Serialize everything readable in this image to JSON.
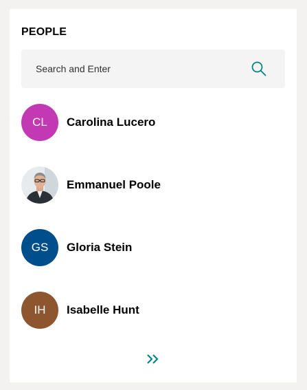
{
  "panel": {
    "title": "PEOPLE"
  },
  "search": {
    "placeholder": "Search and Enter",
    "icon": "search-icon"
  },
  "people": [
    {
      "name": "Carolina Lucero",
      "initials": "CL",
      "color": "#c239b3",
      "photo": false
    },
    {
      "name": "Emmanuel Poole",
      "initials": "",
      "color": "#6b7a8a",
      "photo": true
    },
    {
      "name": "Gloria Stein",
      "initials": "GS",
      "color": "#004e8c",
      "photo": false
    },
    {
      "name": "Isabelle Hunt",
      "initials": "IH",
      "color": "#8e562e",
      "photo": false
    }
  ],
  "more": {
    "icon": "double-chevron-right-icon"
  },
  "colors": {
    "accent": "#038387",
    "background": "#f3f2f1",
    "card": "#ffffff",
    "search_background": "#f4f4f4"
  }
}
